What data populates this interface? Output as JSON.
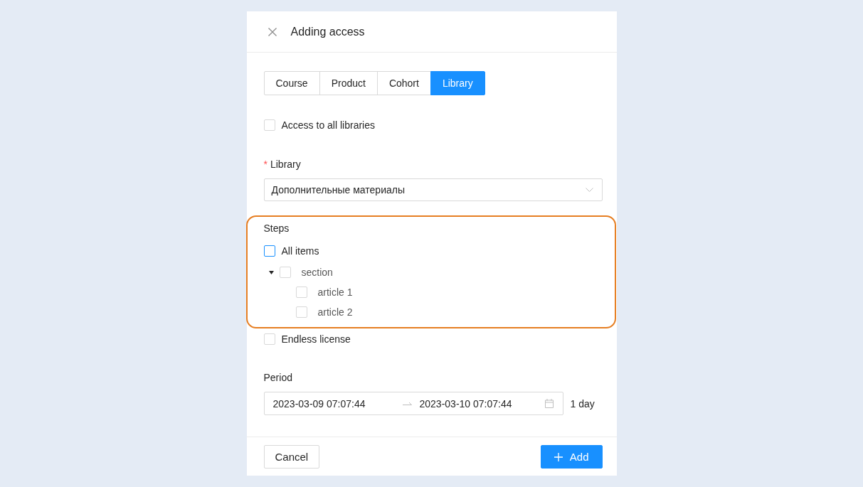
{
  "dialog": {
    "title": "Adding access"
  },
  "tabs": [
    {
      "label": "Course",
      "selected": false
    },
    {
      "label": "Product",
      "selected": false
    },
    {
      "label": "Cohort",
      "selected": false
    },
    {
      "label": "Library",
      "selected": true
    }
  ],
  "all_libraries": {
    "label": "Access to all libraries",
    "checked": false
  },
  "library_field": {
    "required_mark": "*",
    "label": "Library",
    "value": "Дополнительные материалы"
  },
  "steps": {
    "highlighted": true,
    "label": "Steps",
    "all_items": {
      "label": "All items",
      "checked": false,
      "focused": true
    },
    "tree": [
      {
        "label": "section",
        "checked": false,
        "expanded": true,
        "children": [
          {
            "label": "article 1",
            "checked": false
          },
          {
            "label": "article 2",
            "checked": false
          }
        ]
      }
    ]
  },
  "endless_license": {
    "label": "Endless license",
    "checked": false
  },
  "period": {
    "label": "Period",
    "start": "2023-03-09 07:07:44",
    "end": "2023-03-10 07:07:44",
    "duration": "1 day"
  },
  "buttons": [
    {
      "label": "Cancel",
      "kind": "secondary"
    },
    {
      "label": "Add",
      "kind": "primary"
    }
  ]
}
